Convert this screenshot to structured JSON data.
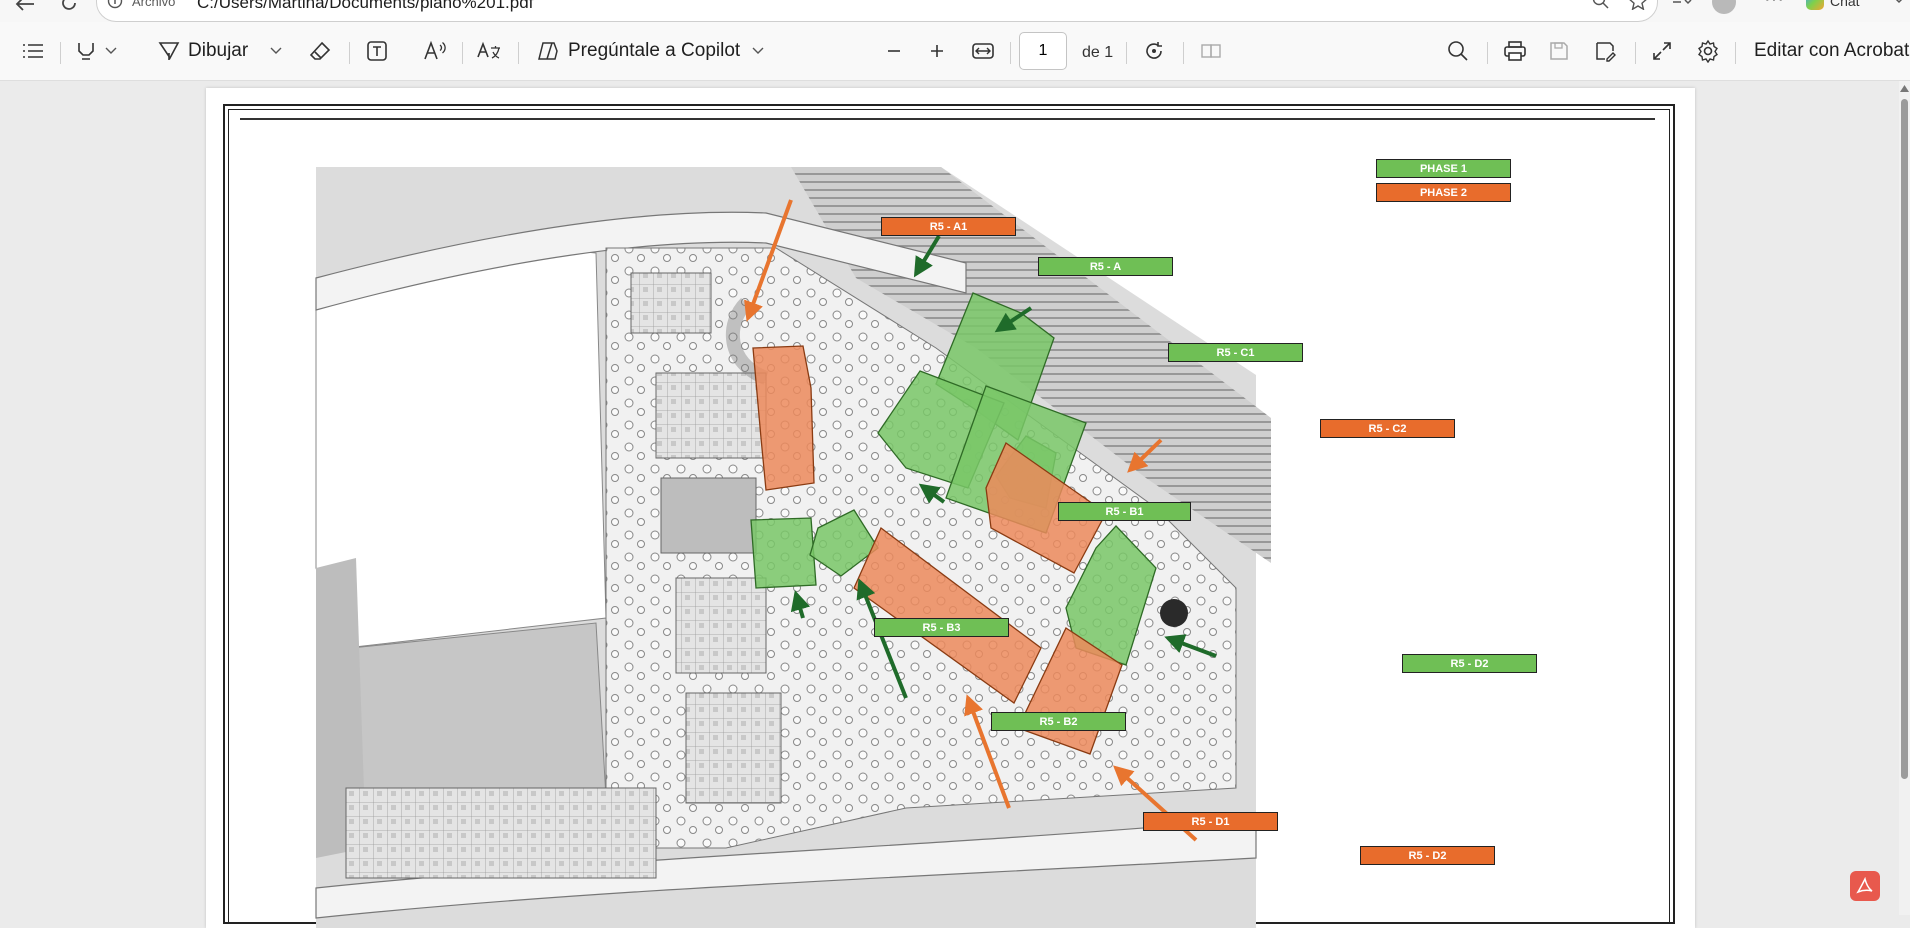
{
  "browser": {
    "file_label": "Archivo",
    "url": "C:/Users/Martina/Documents/plano%201.pdf",
    "chat_label": "Chat"
  },
  "toolbar": {
    "draw_label": "Dibujar",
    "copilot_label": "Pregúntale a Copilot",
    "page_current": "1",
    "page_of": "de 1",
    "edit_acrobat_label": "Editar con Acrobat"
  },
  "legend": {
    "phase1": "PHASE 1",
    "phase2": "PHASE 2"
  },
  "labels": {
    "r5_a1": "R5 - A1",
    "r5_a": "R5 - A",
    "r5_c1": "R5 - C1",
    "r5_c2": "R5 - C2",
    "r5_b1": "R5 - B1",
    "r5_b3": "R5 - B3",
    "r5_b2": "R5 - B2",
    "r5_d2_green": "R5 - D2",
    "r5_d1": "R5 - D1",
    "r5_d2_orange": "R5 - D2"
  },
  "colors": {
    "phase1": "#6fbf55",
    "phase2": "#e86c2c",
    "arrow_green": "#1f6b2a",
    "arrow_orange": "#e8752f"
  }
}
